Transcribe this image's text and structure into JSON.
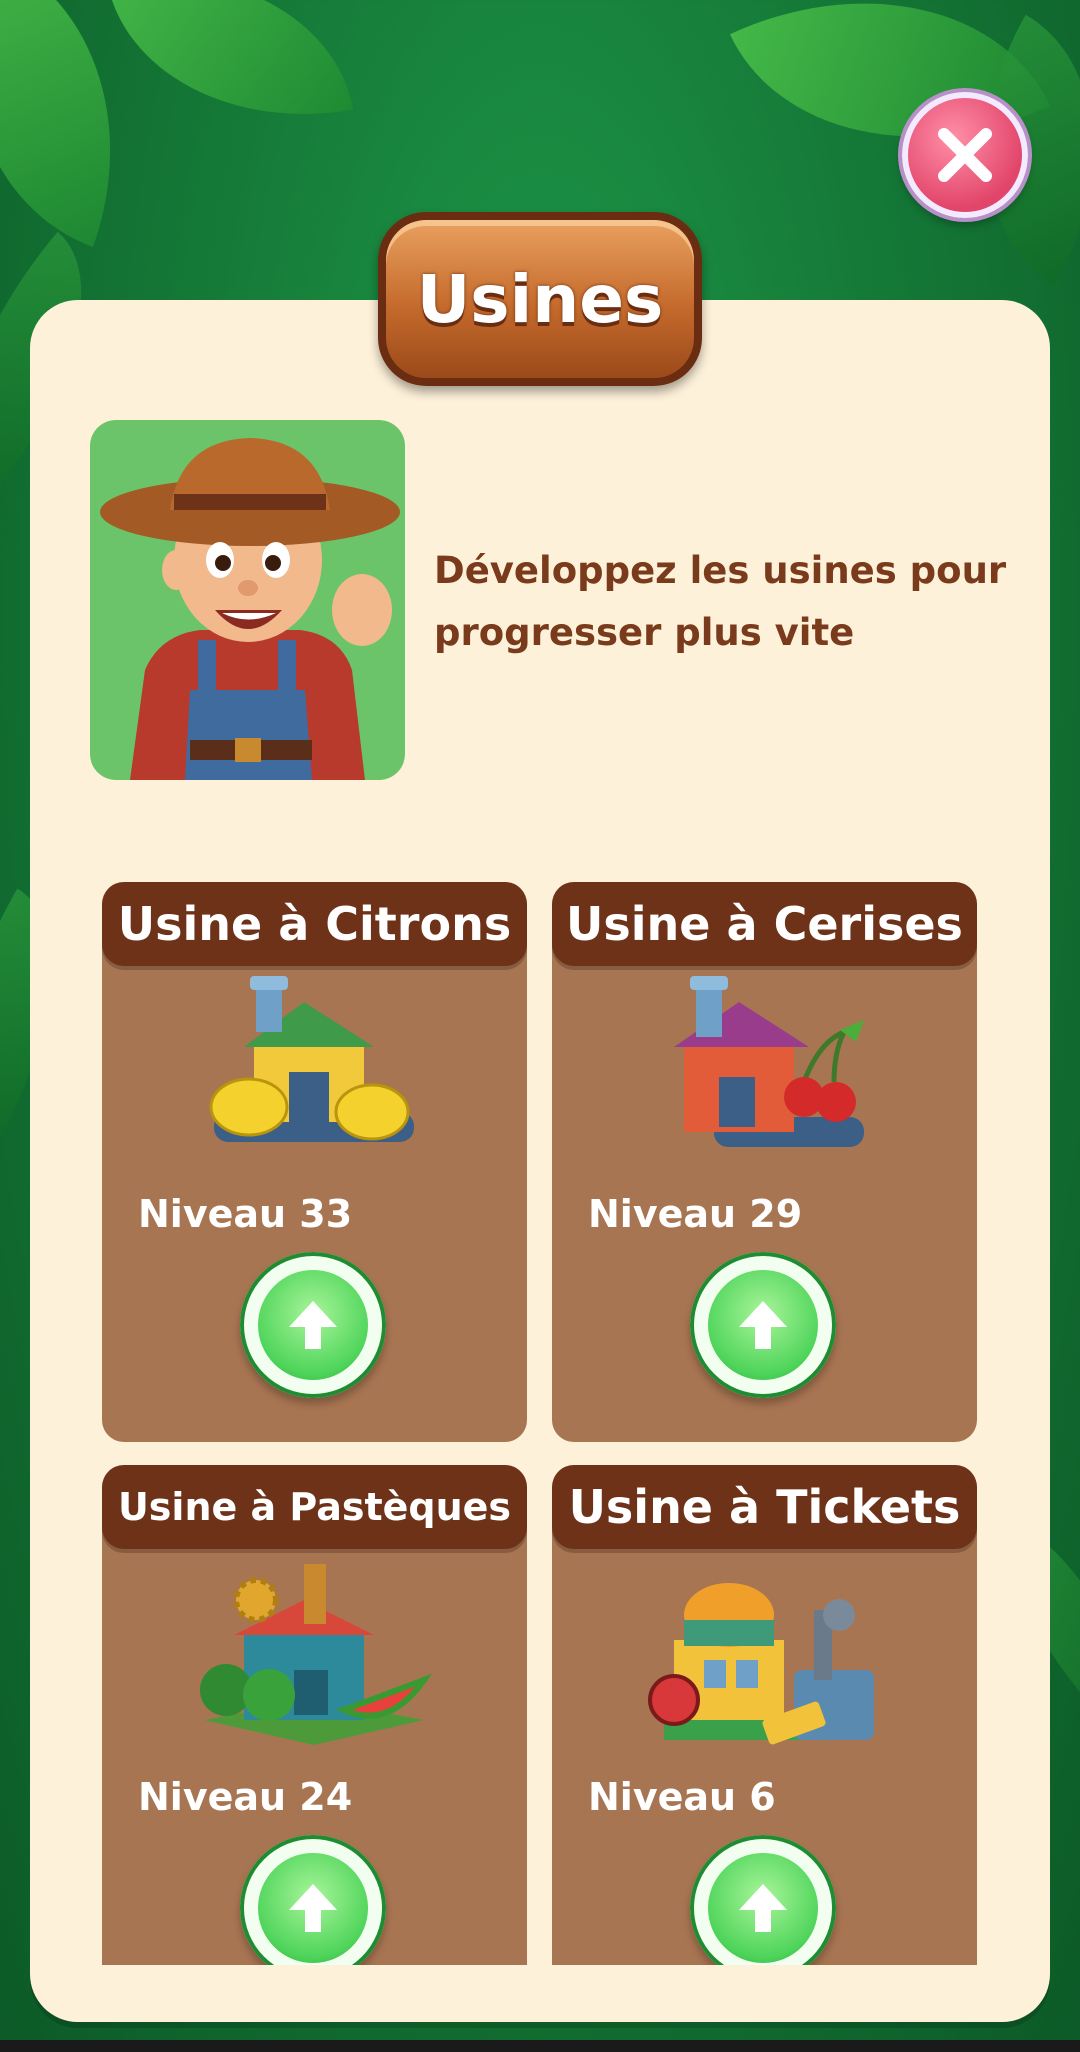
{
  "title": "Usines",
  "intro": {
    "text": "Développez les usines pour progresser plus vite"
  },
  "factories": [
    {
      "name": "Usine à Citrons",
      "level": "Niveau 33",
      "icon": "lemon-factory-icon"
    },
    {
      "name": "Usine à Cerises",
      "level": "Niveau 29",
      "icon": "cherry-factory-icon"
    },
    {
      "name": "Usine à Pastèques",
      "level": "Niveau 24",
      "icon": "watermelon-factory-icon"
    },
    {
      "name": "Usine à Tickets",
      "level": "Niveau 6",
      "icon": "ticket-factory-icon"
    }
  ],
  "colors": {
    "panel": "#fdf1d9",
    "card": "#a87552",
    "card_header": "#6e3219",
    "upgrade": "#4ed45a",
    "close": "#e2456a"
  }
}
